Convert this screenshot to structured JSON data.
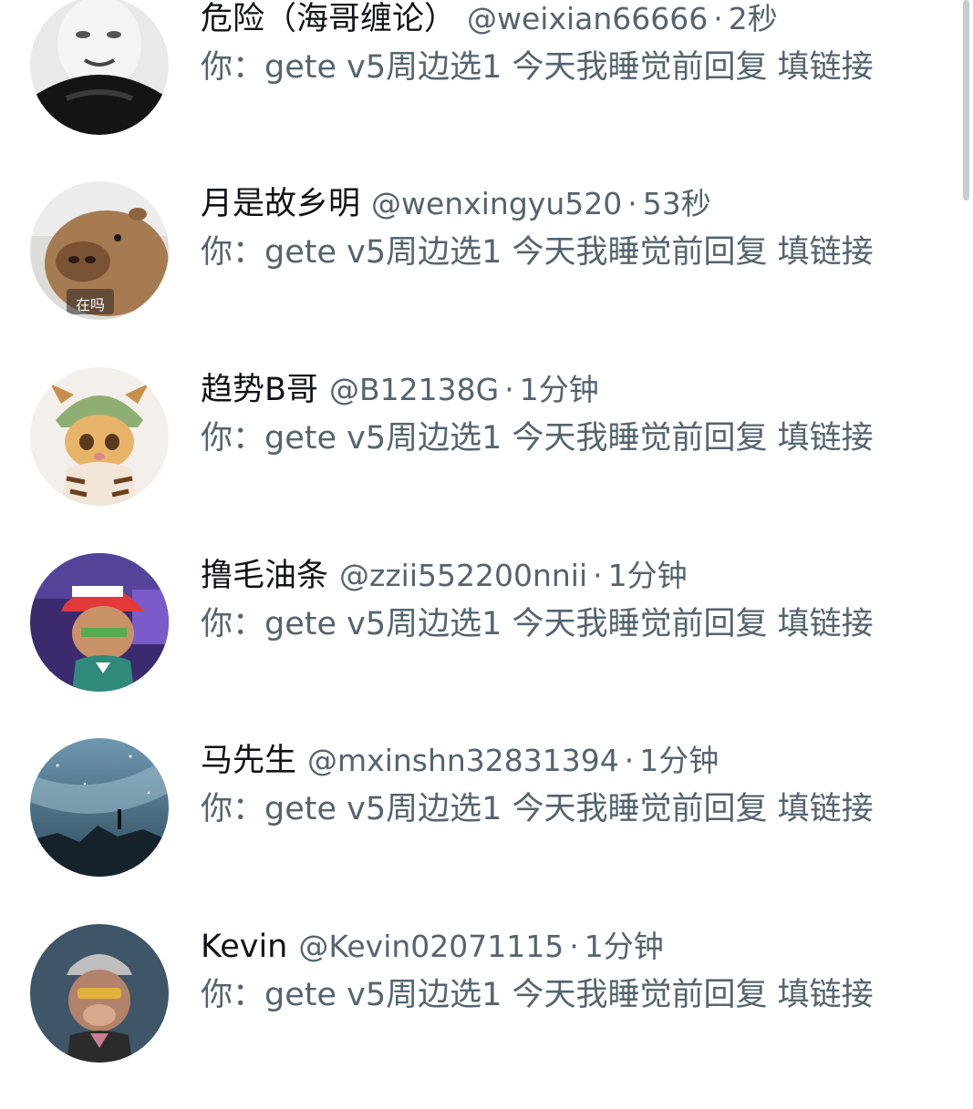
{
  "conversations": [
    {
      "name": "危险（海哥缠论）",
      "handle": "@weixian66666",
      "time": "2秒",
      "preview": "你：gete v5周边选1 今天我睡觉前回复 填链接",
      "avatar": "meme-face-avatar"
    },
    {
      "name": "月是故乡明",
      "handle": "@wenxingyu520",
      "time": "53秒",
      "preview": "你：gete v5周边选1 今天我睡觉前回复 填链接",
      "avatar": "capybara-avatar",
      "avatar_caption": "在吗"
    },
    {
      "name": "趋势B哥",
      "handle": "@B12138G",
      "time": "1分钟",
      "preview": "你：gete v5周边选1 今天我睡觉前回复 填链接",
      "avatar": "tiger-cat-avatar"
    },
    {
      "name": "撸毛油条",
      "handle": "@zzii552200nnii",
      "time": "1分钟",
      "preview": "你：gete v5周边选1 今天我睡觉前回复 填链接",
      "avatar": "cartoon-cap-avatar"
    },
    {
      "name": "马先生",
      "handle": "@mxinshn32831394",
      "time": "1分钟",
      "preview": "你：gete v5周边选1 今天我睡觉前回复 填链接",
      "avatar": "galaxy-avatar"
    },
    {
      "name": "Kevin",
      "handle": "@Kevin02071115",
      "time": "1分钟",
      "preview": "你：gete v5周边选1 今天我睡觉前回复 填链接",
      "avatar": "ape-avatar"
    }
  ],
  "separator": "·"
}
